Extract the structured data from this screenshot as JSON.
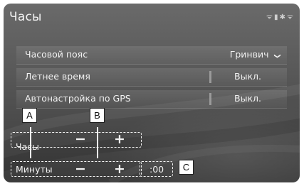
{
  "header": {
    "title": "Часы",
    "status_icons": "ᯤ▮✱ᯤ"
  },
  "settings": [
    {
      "label": "Часовой пояс",
      "value": "Гринвич",
      "chevron": "❯"
    },
    {
      "label": "Летнее время",
      "value": "Выкл."
    },
    {
      "label": "Автонастройка по GPS",
      "value": "Выкл."
    }
  ],
  "adjust": {
    "hours_label": "Часы",
    "minutes_label": "Минуты",
    "minus": "−",
    "plus": "+",
    "reset_label": ":00"
  },
  "callouts": {
    "a": "A",
    "b": "B",
    "c": "C"
  }
}
